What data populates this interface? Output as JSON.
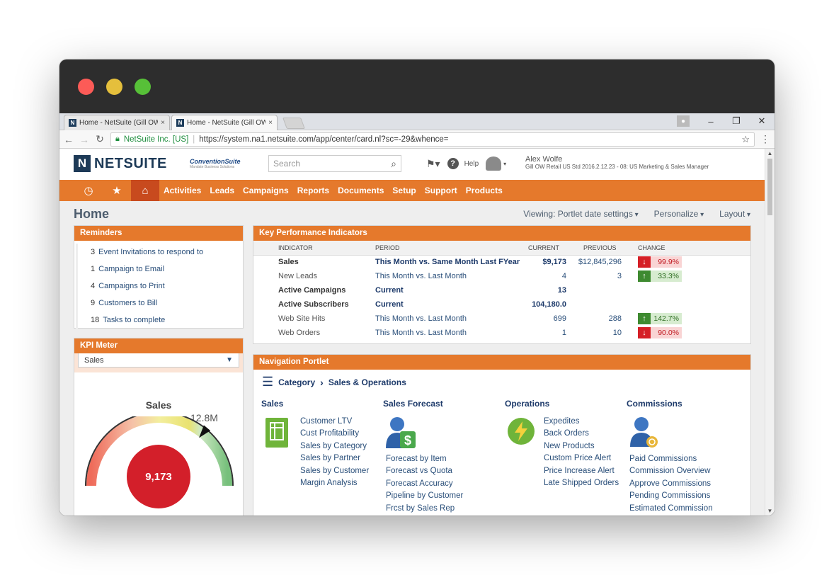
{
  "browser": {
    "tabs": [
      {
        "title": "Home - NetSuite (Gill OW",
        "close": "×"
      },
      {
        "title": "Home - NetSuite (Gill OW",
        "close": "×"
      }
    ],
    "security_label": "NetSuite Inc. [US]",
    "url": "https://system.na1.netsuite.com/app/center/card.nl?sc=-29&whence="
  },
  "header": {
    "logo_text": "NETSUITE",
    "logo_mark": "N",
    "partner_logo": "ConventionSuite",
    "partner_tagline": "Mandate Business Solutions",
    "search_placeholder": "Search",
    "help_label": "Help",
    "user_name": "Alex Wolfe",
    "user_role": "Gill OW Retail US Std 2016.2.12.23 - 08: US Marketing & Sales Manager"
  },
  "nav": {
    "tabs": [
      "Activities",
      "Leads",
      "Campaigns",
      "Reports",
      "Documents",
      "Setup",
      "Support",
      "Products"
    ]
  },
  "page": {
    "title": "Home",
    "options": [
      "Viewing: Portlet date settings",
      "Personalize",
      "Layout"
    ]
  },
  "reminders": {
    "title": "Reminders",
    "items": [
      {
        "count": "3",
        "label": "Event Invitations to respond to"
      },
      {
        "count": "1",
        "label": "Campaign to Email"
      },
      {
        "count": "4",
        "label": "Campaigns to Print"
      },
      {
        "count": "9",
        "label": "Customers to Bill"
      },
      {
        "count": "18",
        "label": "Tasks to complete"
      }
    ]
  },
  "kpi_meter": {
    "title": "KPI Meter",
    "selected": "Sales",
    "gauge_title": "Sales",
    "gauge_max": "12.8M",
    "gauge_value": "9,173",
    "gauge_fraction": 0.72
  },
  "kpi": {
    "title": "Key Performance Indicators",
    "columns": [
      "INDICATOR",
      "PERIOD",
      "CURRENT",
      "PREVIOUS",
      "CHANGE"
    ],
    "rows": [
      {
        "indicator": "Sales",
        "period": "This Month vs. Same Month Last FYear",
        "current": "$9,173",
        "previous": "$12,845,296",
        "change": "99.9%",
        "dir": "down",
        "bold": true
      },
      {
        "indicator": "New Leads",
        "period": "This Month vs. Last Month",
        "current": "4",
        "previous": "3",
        "change": "33.3%",
        "dir": "up",
        "bold": false
      },
      {
        "indicator": "Active Campaigns",
        "period": "Current",
        "current": "13",
        "previous": "",
        "change": "",
        "dir": "",
        "bold": true
      },
      {
        "indicator": "Active Subscribers",
        "period": "Current",
        "current": "104,180.0",
        "previous": "",
        "change": "",
        "dir": "",
        "bold": true
      },
      {
        "indicator": "Web Site Hits",
        "period": "This Month vs. Last Month",
        "current": "699",
        "previous": "288",
        "change": "142.7%",
        "dir": "up",
        "bold": false
      },
      {
        "indicator": "Web Orders",
        "period": "This Month vs. Last Month",
        "current": "1",
        "previous": "10",
        "change": "90.0%",
        "dir": "down",
        "bold": false
      }
    ]
  },
  "navigation": {
    "title": "Navigation Portlet",
    "crumb_category": "Category",
    "crumb_current": "Sales & Operations",
    "columns": [
      {
        "heading": "Sales",
        "links": [
          "Customer LTV",
          "Cust Profitability",
          "Sales by Category",
          "Sales by Partner",
          "Sales by Customer",
          "Margin Analysis"
        ]
      },
      {
        "heading": "Sales Forecast",
        "links": [
          "Forecast by Item",
          "Forecast vs Quota",
          "Forecast Accuracy",
          "Pipeline by Customer",
          "Frcst by Sales Rep"
        ]
      },
      {
        "heading": "Operations",
        "links": [
          "Expedites",
          "Back Orders",
          "New Products",
          "Custom Price Alert",
          "Price Increase Alert",
          "Late Shipped Orders"
        ]
      },
      {
        "heading": "Commissions",
        "links": [
          "Paid Commissions",
          "Commission Overview",
          "Approve Commissions",
          "Pending Commissions",
          "Estimated Commission"
        ]
      }
    ]
  },
  "colors": {
    "orange": "#e5792c",
    "navy": "#1d3a6a",
    "red": "#d31f2a",
    "green": "#3e8a30"
  }
}
